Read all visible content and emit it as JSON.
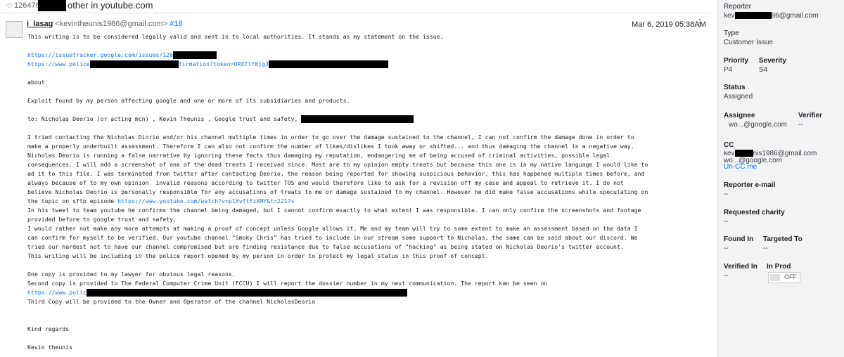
{
  "header": {
    "star_icon": "star-outline-icon",
    "issue_id": "126476",
    "title": "other in youtube.com"
  },
  "comment": {
    "author_name": "i_lasag",
    "author_email": "<kevintheunis1986@gmail.com>",
    "comment_number": "#18",
    "date": "Mar 6, 2019 05:38AM",
    "more_icon": "more-vert-icon",
    "lines": {
      "l1": "This writing is to be considered legally valid and sent in to local authorities. It stands as my statement on the issue.",
      "url1": "https://issuetracker.google.com/issues/126",
      "url2a": "https://www.police",
      "url2b": "firmation?token=ORXTlY8jgJ",
      "about": "about",
      "exploit": "Exploit found by my person affecting google and one or more of its subsidiaries and products.",
      "to": "to: Nicholas Deorio (or acting mcn) , Kevin Theunis , Google trust and safety,",
      "p1": "I tried contacting the Nicholas Diorio and/or his channel multiple times in order to go over the damage sustained to the channel, I can not confirm the damage done in order to\nmake a properly underbuilt assessment. Therefore I can also not confirm the number of likes/dislikes I took away or shifted... and thus damaging the channel in a negative way.\nNicholas Deorio is running a false narrative by ignoring these facts thus damaging my reputation, endangering me of being accused of criminal activities, possible legal\nconsequences. I will add a screenshot of one of the dead treats I received since. Most are to my opinion empty treats but because this one is in my native language I would like to\nad it to this file. I was terminated from twitter after contacting Deorio, the reason being reported for showing suspicious behavior, this has happened multiple times before, and\nalways because of to my own opinion  invalid reasons according to twitter TOS and would therefore like to ask for a revision off my case and appeal to retrieve it. I do not\nbelieve Nicholas Deorio is personally responsible for any accusations of treats to me or damage sustained to my channel. However he did make false accusations while speculating on\nthe topic on sftp episode ",
      "yt_link": "https://www.youtube.com/watch?v=p1XvftFzXMY&t=2217s",
      "p2": "In his tweet to team youtube he confirms the channel being damaged, but I cannot confirm exactly to what extent I was responsible. I can only confirm the screenshots and footage\nprovided before to google trust and safety.\nI would rather not make any more attempts at making a proof of concept unless Google allows it. Me and my team will try to some extent to make an assessment based on the data I\ncan confirm for myself to be verified. Our youtube channel \"Smoky Chris\" has tried to include in our stream some support to Nicholas, the same can be said about our discord. We\ntried our hardest not to have our channel compromised but are finding resistance due to false accusations of \"hacking\" as being stated on Nicholas Deorio's twitter account.\nThis writing will be including in the police report opened by my person in order to protect my legal status in this proof of concept.",
      "c1": "One copy is provided to my lawyer for obvious legal reasons.",
      "c2": "Second copy is provided to The Federal Computer Crime Unit (FCCU) I will report the dossier number in my next communication. The report kan be seen on",
      "url3": "https://www.polic",
      "c3": "Third Copy will be provided to the Owner and Operator of the channel NicholasDeorio",
      "regards": "Kind regards",
      "sign": "Kevin theunis"
    }
  },
  "sidebar": {
    "reporter_label": "Reporter",
    "reporter_value_a": "kev",
    "reporter_value_b": "86@gmail.com",
    "type_label": "Type",
    "type_value": "Customer Issue",
    "priority_label": "Priority",
    "priority_value": "P4",
    "severity_label": "Severity",
    "severity_value": "S4",
    "status_label": "Status",
    "status_value": "Assigned",
    "assignee_label": "Assignee",
    "assignee_value": "wo...@google.com",
    "verifier_label": "Verifier",
    "verifier_value": "--",
    "cc_label": "CC",
    "cc_value_a": "kev",
    "cc_value_b": "nis1986@gmail.com",
    "cc_value_2": "wo...@google.com",
    "cc_action": "Un-CC me",
    "reporter_email_label": "Reporter e-mail",
    "reporter_email_value": "--",
    "charity_label": "Requested charity",
    "charity_value": "--",
    "found_in_label": "Found In",
    "found_in_value": "--",
    "targeted_label": "Targeted To",
    "targeted_value": "--",
    "verified_in_label": "Verified In",
    "verified_in_value": "--",
    "in_prod_label": "In Prod",
    "in_prod_value": "OFF"
  }
}
